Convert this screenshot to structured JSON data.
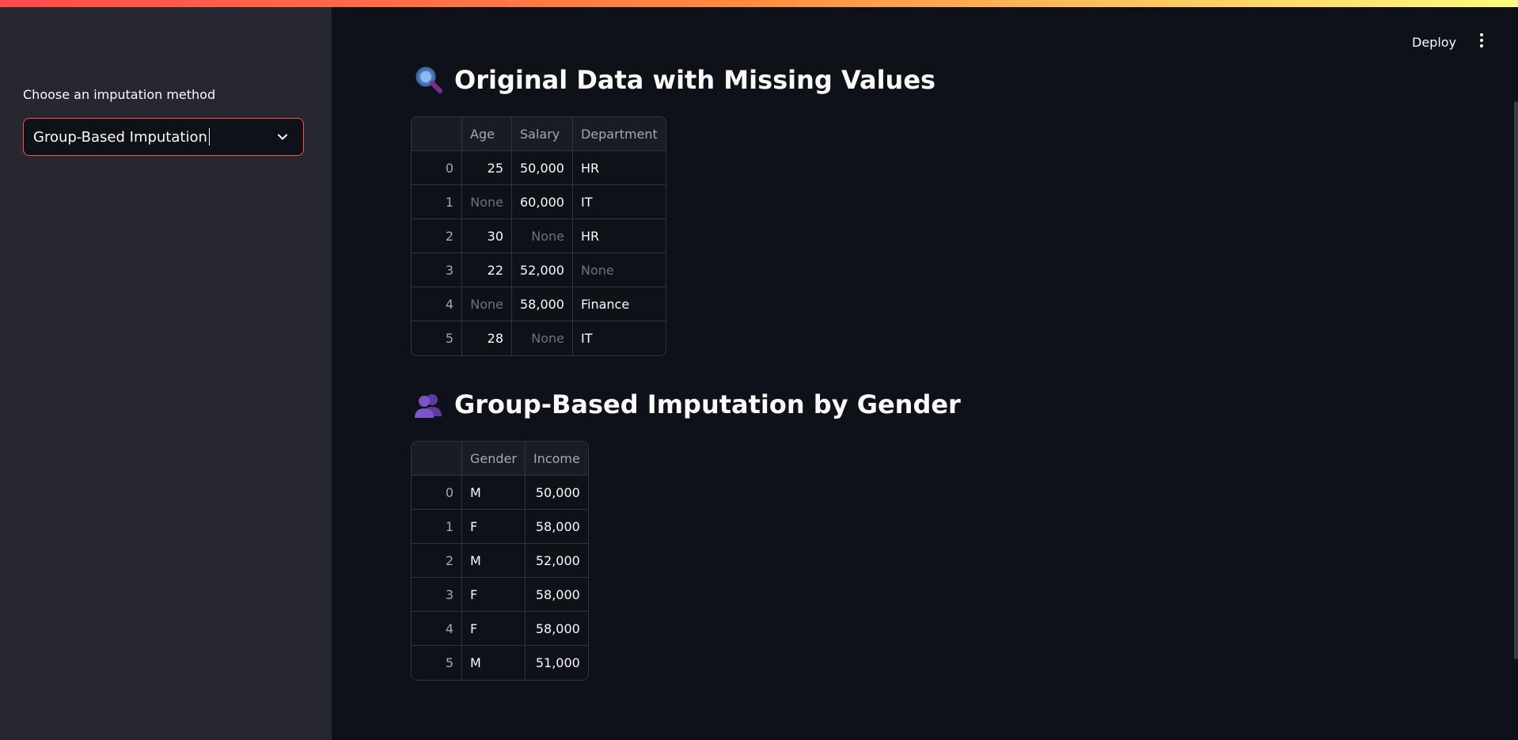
{
  "sidebar": {
    "select_label": "Choose an imputation method",
    "select_value": "Group-Based Imputation"
  },
  "header": {
    "deploy_label": "Deploy"
  },
  "section1": {
    "title": "Original Data with Missing Values",
    "icon": "magnifying-glass-icon",
    "columns": [
      "",
      "Age",
      "Salary",
      "Department"
    ],
    "rows": [
      {
        "index": "0",
        "age": "25",
        "salary": "50,000",
        "department": "HR"
      },
      {
        "index": "1",
        "age": "None",
        "salary": "60,000",
        "department": "IT"
      },
      {
        "index": "2",
        "age": "30",
        "salary": "None",
        "department": "HR"
      },
      {
        "index": "3",
        "age": "22",
        "salary": "52,000",
        "department": "None"
      },
      {
        "index": "4",
        "age": "None",
        "salary": "58,000",
        "department": "Finance"
      },
      {
        "index": "5",
        "age": "28",
        "salary": "None",
        "department": "IT"
      }
    ]
  },
  "section2": {
    "title": "Group-Based Imputation by Gender",
    "icon": "people-icon",
    "columns": [
      "",
      "Gender",
      "Income"
    ],
    "rows": [
      {
        "index": "0",
        "gender": "M",
        "income": "50,000"
      },
      {
        "index": "1",
        "gender": "F",
        "income": "58,000"
      },
      {
        "index": "2",
        "gender": "M",
        "income": "52,000"
      },
      {
        "index": "3",
        "gender": "F",
        "income": "58,000"
      },
      {
        "index": "4",
        "gender": "F",
        "income": "58,000"
      },
      {
        "index": "5",
        "gender": "M",
        "income": "51,000"
      }
    ]
  },
  "colors": {
    "accent": "#ff4b4b",
    "background": "#0e1117",
    "sidebar": "#262730"
  }
}
